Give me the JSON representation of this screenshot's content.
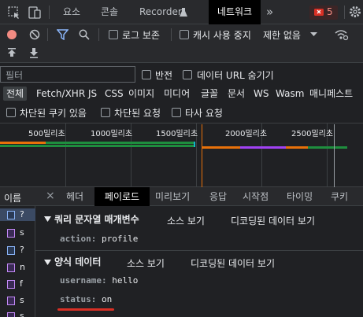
{
  "top_tabs": [
    "요소",
    "콘솔",
    "Recorder",
    "네트워크"
  ],
  "top_more": "»",
  "error_count": "5",
  "toolbar": {
    "preserve_log": "로그 보존",
    "disable_cache": "캐시 사용 중지",
    "throttling": "제한 없음"
  },
  "filter": {
    "placeholder": "필터",
    "invert": "반전",
    "hide_data_urls": "데이터 URL 숨기기"
  },
  "type_filters": [
    "전체",
    "Fetch/XHR",
    "JS",
    "CSS",
    "이미지",
    "미디어",
    "글꼴",
    "문서",
    "WS",
    "Wasm",
    "매니페스트"
  ],
  "cookie_filters": [
    "차단된 쿠키 있음",
    "차단된 요청",
    "타사 요청"
  ],
  "timeline_ticks": [
    "500밀리초",
    "1000밀리초",
    "1500밀리초",
    "2000밀리초",
    "2500밀리초"
  ],
  "requests_header": "이름",
  "request_rows": [
    {
      "name": "?",
      "type": "doc"
    },
    {
      "name": "s",
      "type": "p"
    },
    {
      "name": "?",
      "type": "doc"
    },
    {
      "name": "n",
      "type": "p"
    },
    {
      "name": "f",
      "type": "p"
    },
    {
      "name": "s",
      "type": "p"
    },
    {
      "name": "s",
      "type": "p"
    }
  ],
  "detail_tabs": [
    "헤더",
    "페이로드",
    "미리보기",
    "응답",
    "시작점",
    "타이밍",
    "쿠키"
  ],
  "detail_close": "×",
  "query_section": {
    "title": "쿼리 문자열 매개변수",
    "view_source": "소스 보기",
    "view_decoded": "디코딩된 데이터 보기",
    "params": [
      {
        "key": "action:",
        "value": "profile"
      }
    ]
  },
  "form_section": {
    "title": "양식 데이터",
    "view_source": "소스 보기",
    "view_decoded": "디코딩된 데이터 보기",
    "params": [
      {
        "key": "username:",
        "value": "hello"
      },
      {
        "key": "status:",
        "value": "on"
      }
    ]
  },
  "colors": {
    "accent_blue": "#8ab4f8",
    "record_red": "#f28b82",
    "underline_red": "#d93025",
    "bar_orange": "#e8710a",
    "bar_green": "#1e8e3e",
    "bar_teal": "#12b5cb",
    "bar_purple": "#a142f4"
  }
}
